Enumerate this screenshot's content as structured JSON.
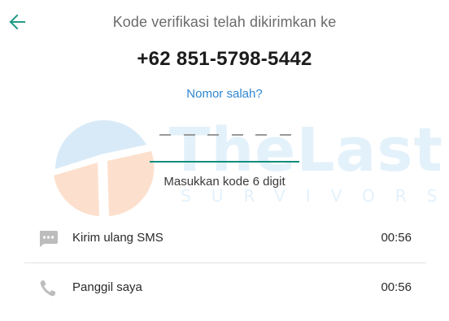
{
  "header": {
    "back_icon": "arrow-left-icon",
    "title": "Kode verifikasi telah dikirimkan ke"
  },
  "phone_number": "+62 851-5798-5442",
  "wrong_number_link": "Nomor salah?",
  "code_input": {
    "value": "",
    "hint": "Masukkan kode 6 digit",
    "digits": 6
  },
  "options": [
    {
      "icon": "message-icon",
      "label": "Kirim ulang SMS",
      "timer": "00:56"
    },
    {
      "icon": "phone-icon",
      "label": "Panggil saya",
      "timer": "00:56"
    }
  ],
  "watermark": {
    "title": "TheLast",
    "subtitle": "SURVIVORS"
  },
  "colors": {
    "accent": "#128c7e",
    "link": "#2f86d1",
    "back_arrow": "#1f9c87"
  }
}
